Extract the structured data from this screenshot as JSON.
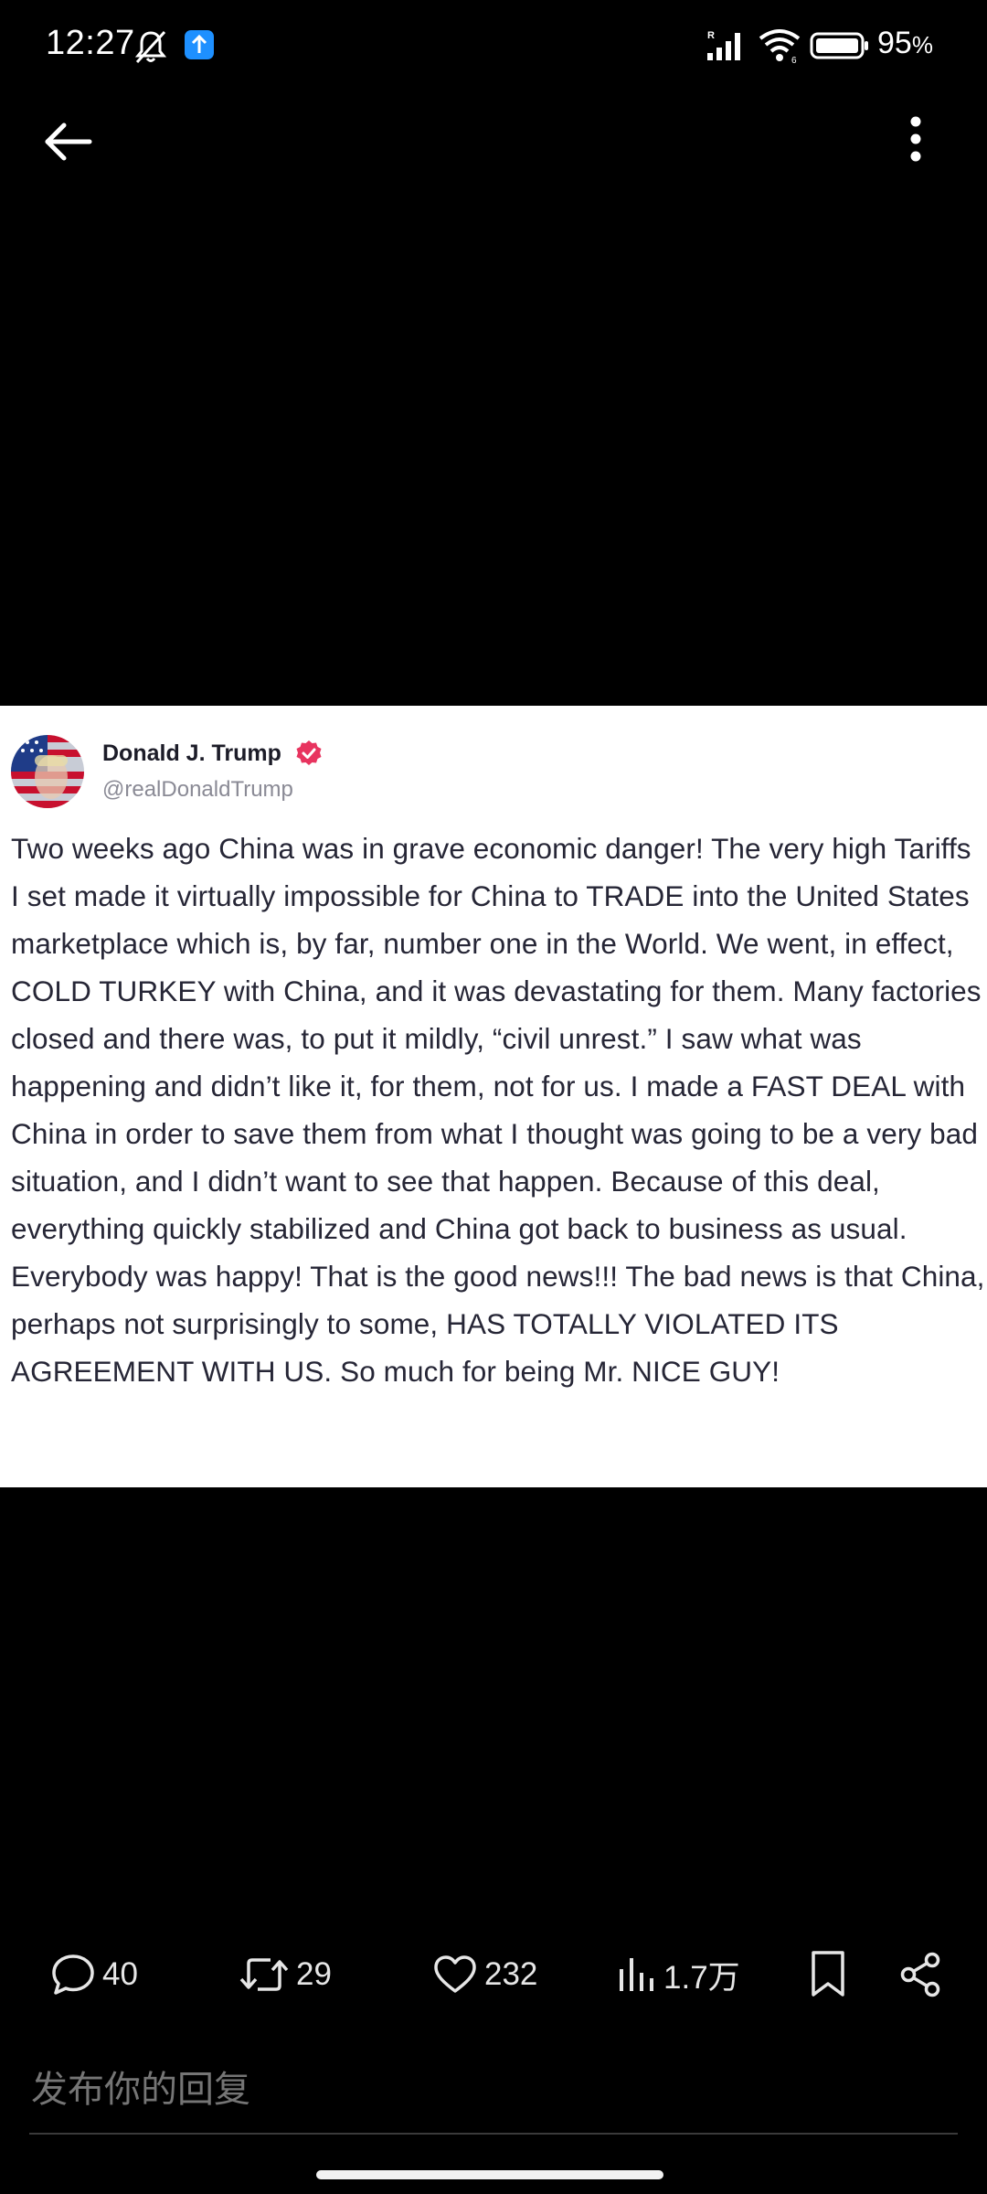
{
  "status_bar": {
    "time": "12:27",
    "battery_percent": "95",
    "battery_unit": "%",
    "icons": [
      "bell-muted-icon",
      "app-upload-badge-icon",
      "signal-icon",
      "wifi-icon",
      "battery-icon"
    ]
  },
  "nav": {
    "icons": [
      "back-arrow-icon",
      "more-vertical-icon"
    ]
  },
  "post": {
    "author_name": "Donald J. Trump",
    "author_handle": "@realDonaldTrump",
    "text": "Two weeks ago China was in grave economic danger! The very high Tariffs I set made it virtually impossible for China to TRADE into the United States marketplace which is, by far, number one in the World. We went, in effect, COLD TURKEY with China, and it was devastating for them. Many factories closed and there was, to put it mildly, “civil unrest.” I saw what was happening and didn’t like it, for them, not for us. I made a FAST DEAL with China in order to save them from what I thought was going to be a very bad situation, and I didn’t want to see that happen. Because of this deal, everything quickly stabilized and China got back to business as usual. Everybody was happy! That is the good news!!! The bad news is that China, perhaps not surprisingly to some, HAS TOTALLY VIOLATED ITS AGREEMENT WITH US. So much for being Mr. NICE GUY!",
    "verified_color": "#e8345f"
  },
  "actions": {
    "replies": "40",
    "reposts": "29",
    "likes": "232",
    "views": "1.7万"
  },
  "reply": {
    "placeholder": "发布你的回复"
  }
}
